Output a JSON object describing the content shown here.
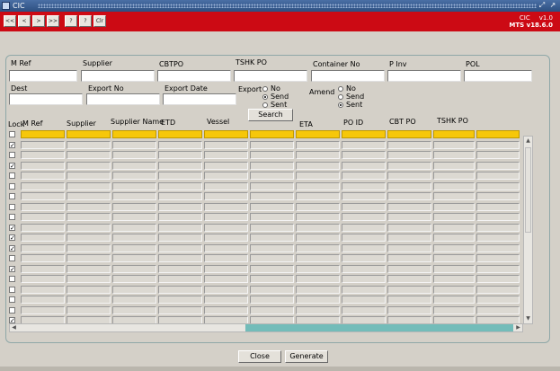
{
  "window": {
    "title": "CIC"
  },
  "brand": {
    "name": "CIC",
    "version": "v1.0",
    "subtitle": "MTS v18.6.0"
  },
  "toolbar": {
    "buttons": [
      {
        "name": "first-record-button",
        "label": "<<"
      },
      {
        "name": "previous-record-button",
        "label": "<"
      },
      {
        "name": "next-record-button",
        "label": ">"
      },
      {
        "name": "last-record-button",
        "label": ">>"
      },
      {
        "name": "query-button",
        "label": "?"
      },
      {
        "name": "help-button",
        "label": "?"
      },
      {
        "name": "clear-button",
        "label": "Clr"
      }
    ]
  },
  "search_form": {
    "m_ref": "M Ref",
    "supplier": "Supplier",
    "cbtpo": "CBTPO",
    "tshk_po": "TSHK PO",
    "container_no": "Container No",
    "p_inv": "P Inv",
    "pol": "POL",
    "dest": "Dest",
    "export_no": "Export No",
    "export_date": "Export Date",
    "export_label": "Export",
    "export_options": [
      "No",
      "Send",
      "Sent"
    ],
    "export_selected": "Send",
    "amend_label": "Amend",
    "amend_options": [
      "No",
      "Send",
      "Sent"
    ],
    "amend_selected": "Sent",
    "search_button": "Search"
  },
  "grid": {
    "columns": [
      "Lock",
      "M Ref",
      "Supplier",
      "Supplier Name",
      "ETD",
      "Vessel",
      "ETA",
      "PO ID",
      "CBT PO",
      "TSHK PO"
    ],
    "row_locks": [
      false,
      true,
      false,
      true,
      false,
      false,
      false,
      false,
      false,
      true,
      true,
      true,
      false,
      true,
      false,
      false,
      false,
      false,
      true
    ]
  },
  "footer": {
    "close": "Close",
    "generate": "Generate"
  }
}
